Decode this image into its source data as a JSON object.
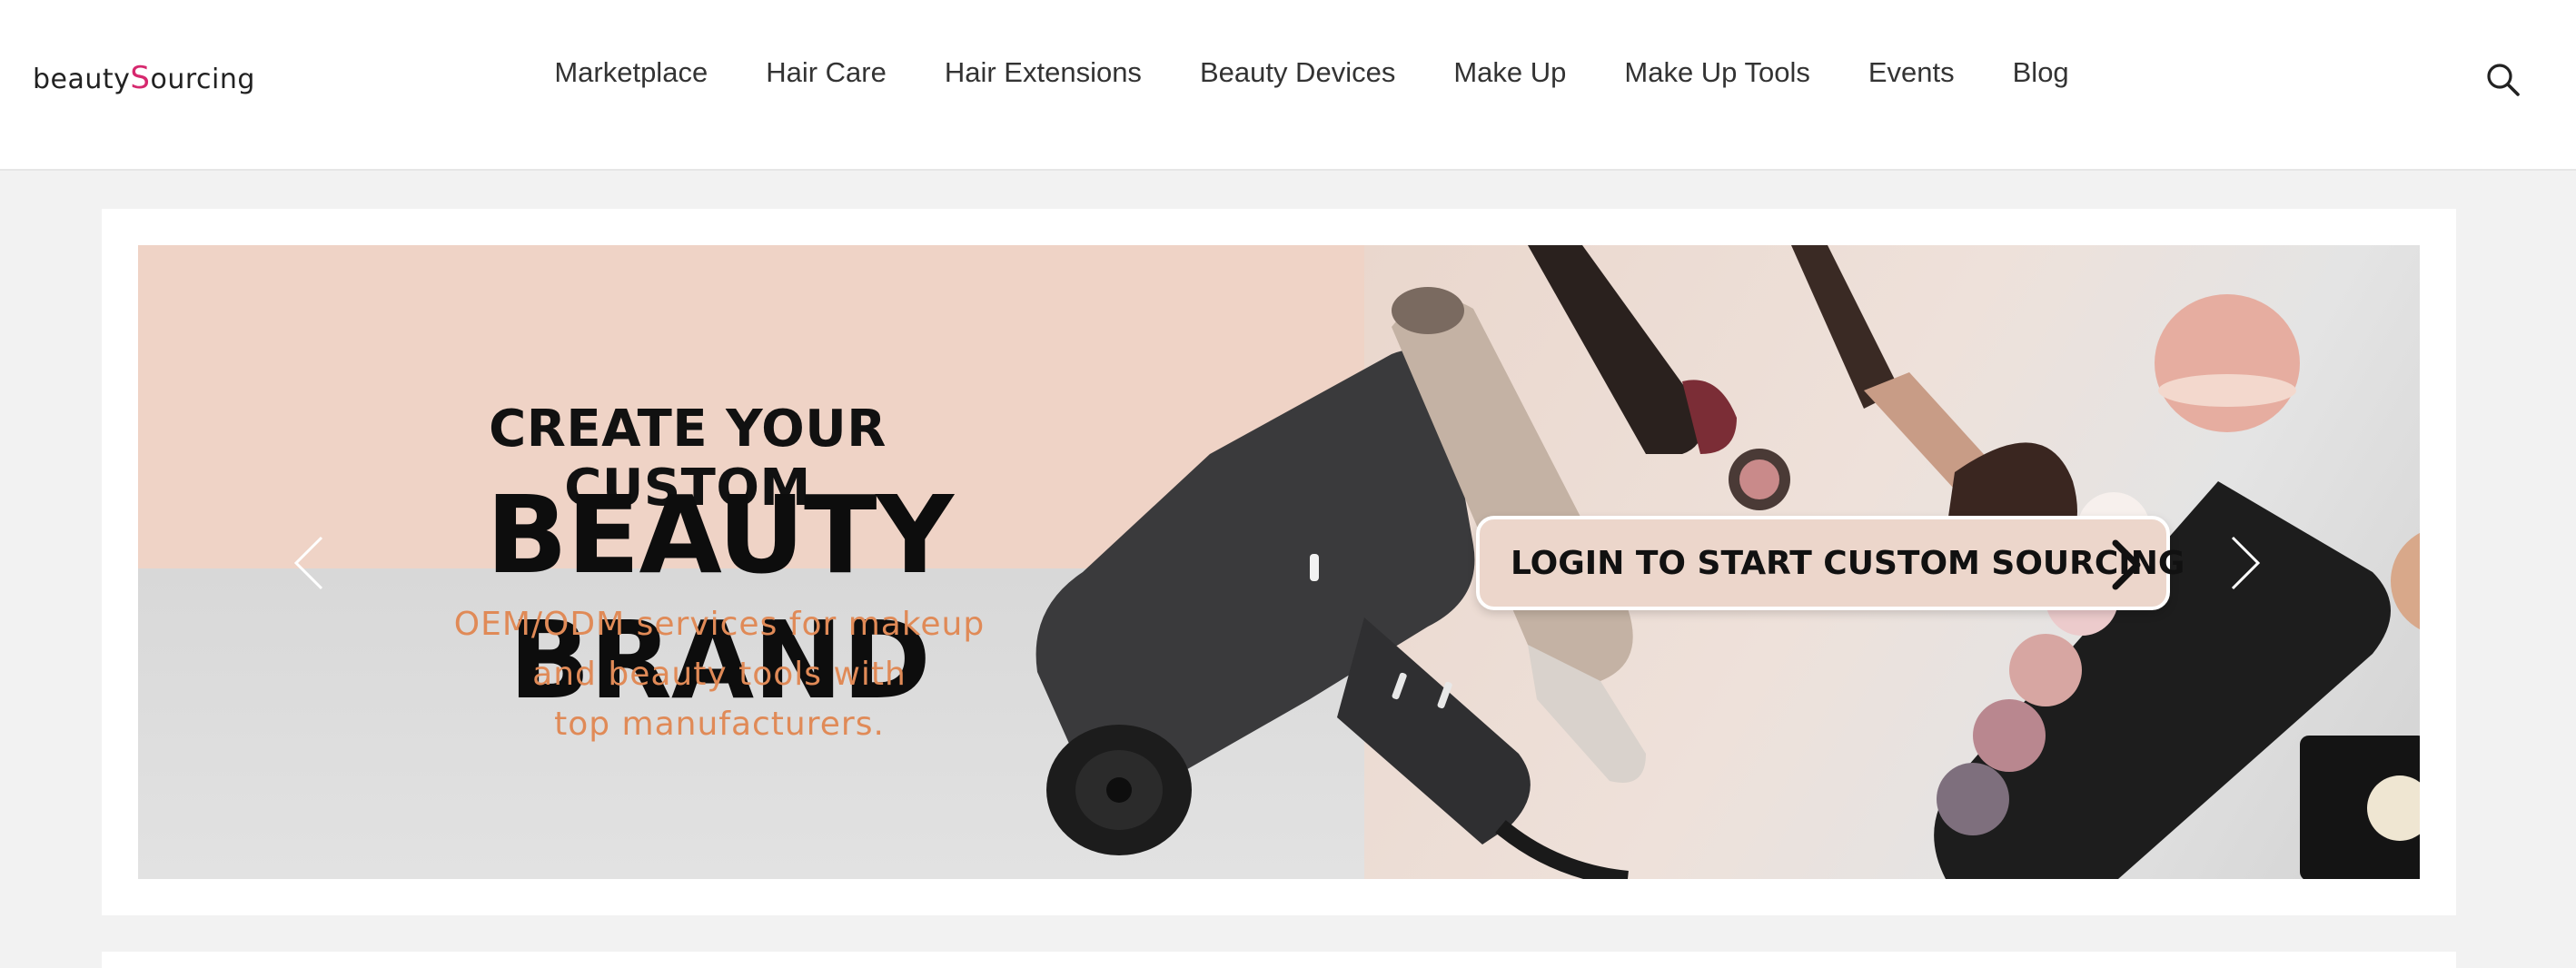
{
  "header": {
    "logo": {
      "text_main": "beauty",
      "text_accent": "S",
      "text_rest": "ourcing",
      "accent_color": "#d6286e"
    },
    "nav": [
      {
        "label": "Marketplace"
      },
      {
        "label": "Hair Care"
      },
      {
        "label": "Hair Extensions"
      },
      {
        "label": "Beauty Devices"
      },
      {
        "label": "Make Up"
      },
      {
        "label": "Make Up Tools"
      },
      {
        "label": "Events"
      },
      {
        "label": "Blog"
      }
    ],
    "search_icon": "search-icon"
  },
  "banner": {
    "headline_line1": "CREATE YOUR CUSTOM",
    "headline_line2": "BEAUTY BRAND",
    "subtext_lines": [
      "OEM/ODM services for makeup",
      "and beauty tools with",
      "top manufacturers."
    ],
    "subtext_color": "#e08a57",
    "cta_label": "LOGIN TO START CUSTOM SOURCING",
    "prev_icon": "chevron-left-icon",
    "next_icon": "chevron-right-icon"
  }
}
